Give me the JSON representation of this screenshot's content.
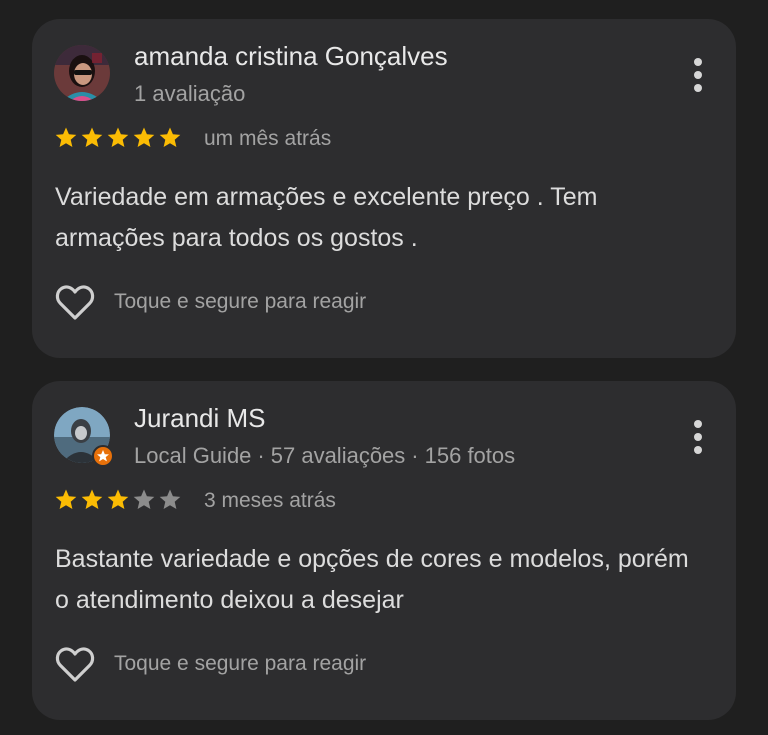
{
  "colors": {
    "background": "#1f1f1f",
    "card": "#2d2d2f",
    "star_filled": "#fbbc04",
    "star_empty": "#8c8c8c",
    "text_primary": "#e8e8e8",
    "text_secondary": "#a3a3a3"
  },
  "reviews": [
    {
      "author": "amanda cristina Gonçalves",
      "meta": [
        "1 avaliação"
      ],
      "rating": 5,
      "max_rating": 5,
      "age": "um mês atrás",
      "text": "Variedade em armações e excelente preço . Tem armações para todos os gostos .",
      "react_label": "Toque e segure para reagir",
      "avatar_icon": "profile-photo",
      "more_icon": "more-vert-icon",
      "react_icon": "heart-outline-icon"
    },
    {
      "author": "Jurandi MS",
      "meta": [
        "Local Guide",
        "57 avaliações",
        "156 fotos"
      ],
      "rating": 3,
      "max_rating": 5,
      "age": "3 meses atrás",
      "text": "Bastante variedade e opções de cores e modelos, porém o atendimento deixou a desejar",
      "react_label": "Toque e segure para reagir",
      "avatar_icon": "profile-photo-with-local-guide-badge",
      "more_icon": "more-vert-icon",
      "react_icon": "heart-outline-icon"
    }
  ]
}
